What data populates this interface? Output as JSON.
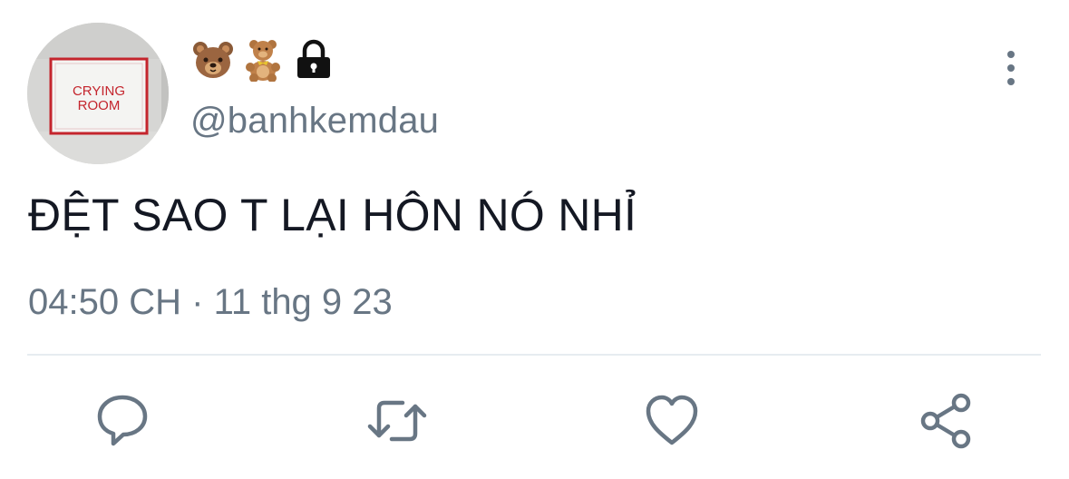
{
  "user": {
    "display_name_icons": [
      "bear-face-icon",
      "teddy-bear-icon",
      "lock-icon"
    ],
    "handle": "@banhkemdau",
    "avatar": {
      "sign_line1": "CRYING",
      "sign_line2": "ROOM"
    }
  },
  "tweet": {
    "text": "ĐỆT SAO T LẠI HÔN NÓ NHỈ",
    "time": "04:50 CH",
    "separator": "·",
    "date": "11 thg 9 23"
  },
  "actions": [
    "reply-icon",
    "retweet-icon",
    "like-icon",
    "share-icon"
  ],
  "colors": {
    "text": "#141823",
    "secondary": "#687684",
    "divider": "#e6ecf0",
    "avatar_sign_red": "#c4252d"
  }
}
